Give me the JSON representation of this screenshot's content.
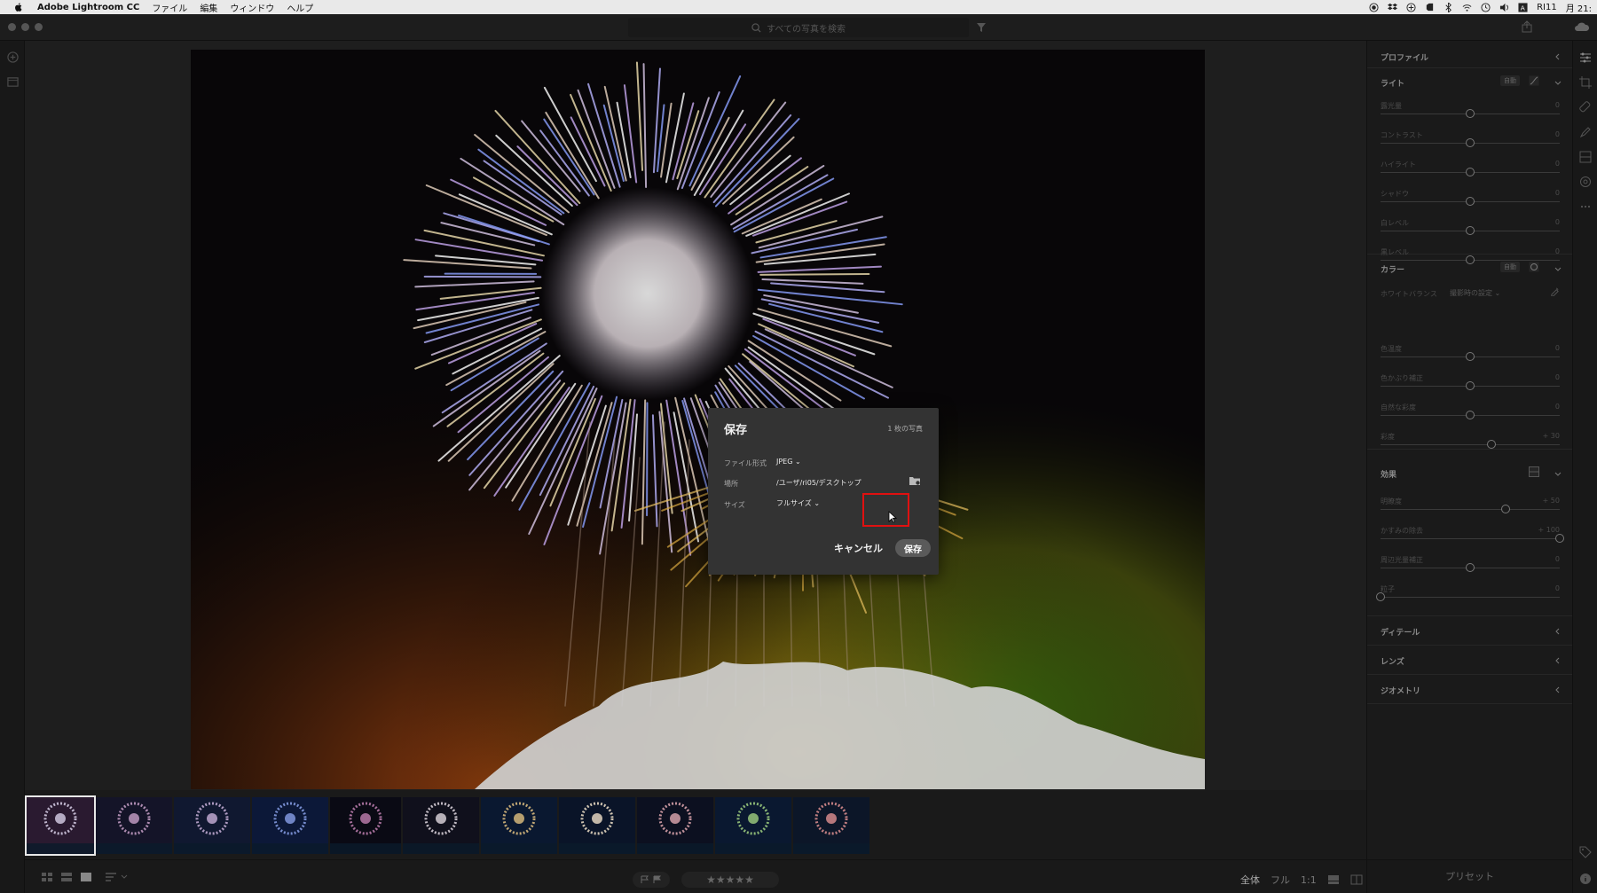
{
  "menubar": {
    "app_name": "Adobe Lightroom CC",
    "items": [
      "ファイル",
      "編集",
      "ウィンドウ",
      "ヘルプ"
    ],
    "user": "RI11",
    "clock": "月 21:"
  },
  "titlebar": {
    "search_placeholder": "すべての写真を検索"
  },
  "right_panel": {
    "profile": "プロファイル",
    "light": {
      "title": "ライト",
      "auto": "自動",
      "sliders": [
        {
          "label": "露光量",
          "value": "0",
          "pos": 0.5
        },
        {
          "label": "コントラスト",
          "value": "0",
          "pos": 0.5
        },
        {
          "label": "ハイライト",
          "value": "0",
          "pos": 0.5
        },
        {
          "label": "シャドウ",
          "value": "0",
          "pos": 0.5
        },
        {
          "label": "白レベル",
          "value": "0",
          "pos": 0.5
        },
        {
          "label": "黒レベル",
          "value": "0",
          "pos": 0.5
        }
      ]
    },
    "color": {
      "title": "カラー",
      "auto": "自動",
      "wb_label": "ホワイトバランス",
      "wb_value": "撮影時の設定",
      "sliders": [
        {
          "label": "色温度",
          "value": "0",
          "pos": 0.5
        },
        {
          "label": "色かぶり補正",
          "value": "0",
          "pos": 0.5
        },
        {
          "label": "自然な彩度",
          "value": "0",
          "pos": 0.5
        },
        {
          "label": "彩度",
          "value": "+ 30",
          "pos": 0.62
        }
      ]
    },
    "effects": {
      "title": "効果",
      "sliders": [
        {
          "label": "明瞭度",
          "value": "+ 50",
          "pos": 0.7
        },
        {
          "label": "かすみの除去",
          "value": "+ 100",
          "pos": 1.0
        },
        {
          "label": "周辺光量補正",
          "value": "0",
          "pos": 0.5
        },
        {
          "label": "粒子",
          "value": "0",
          "pos": 0.0
        }
      ]
    },
    "detail": "ディテール",
    "lens": "レンズ",
    "geometry": "ジオメトリ",
    "presets": "プリセット"
  },
  "bottombar": {
    "zoom_all": "全体",
    "zoom_full": "フル",
    "zoom_1to1": "1:1",
    "stars": "★★★★★"
  },
  "dialog": {
    "title": "保存",
    "count": "1 枚の写真",
    "format_label": "ファイル形式",
    "format_value": "JPEG",
    "location_label": "場所",
    "location_value": "/ユーザ/ri05/デスクトップ",
    "size_label": "サイズ",
    "size_value": "フルサイズ",
    "cancel": "キャンセル",
    "save": "保存"
  },
  "colors": {
    "highlight": "#e01010",
    "dialog_bg": "#333333",
    "panel_bg": "#1a1a1a"
  }
}
